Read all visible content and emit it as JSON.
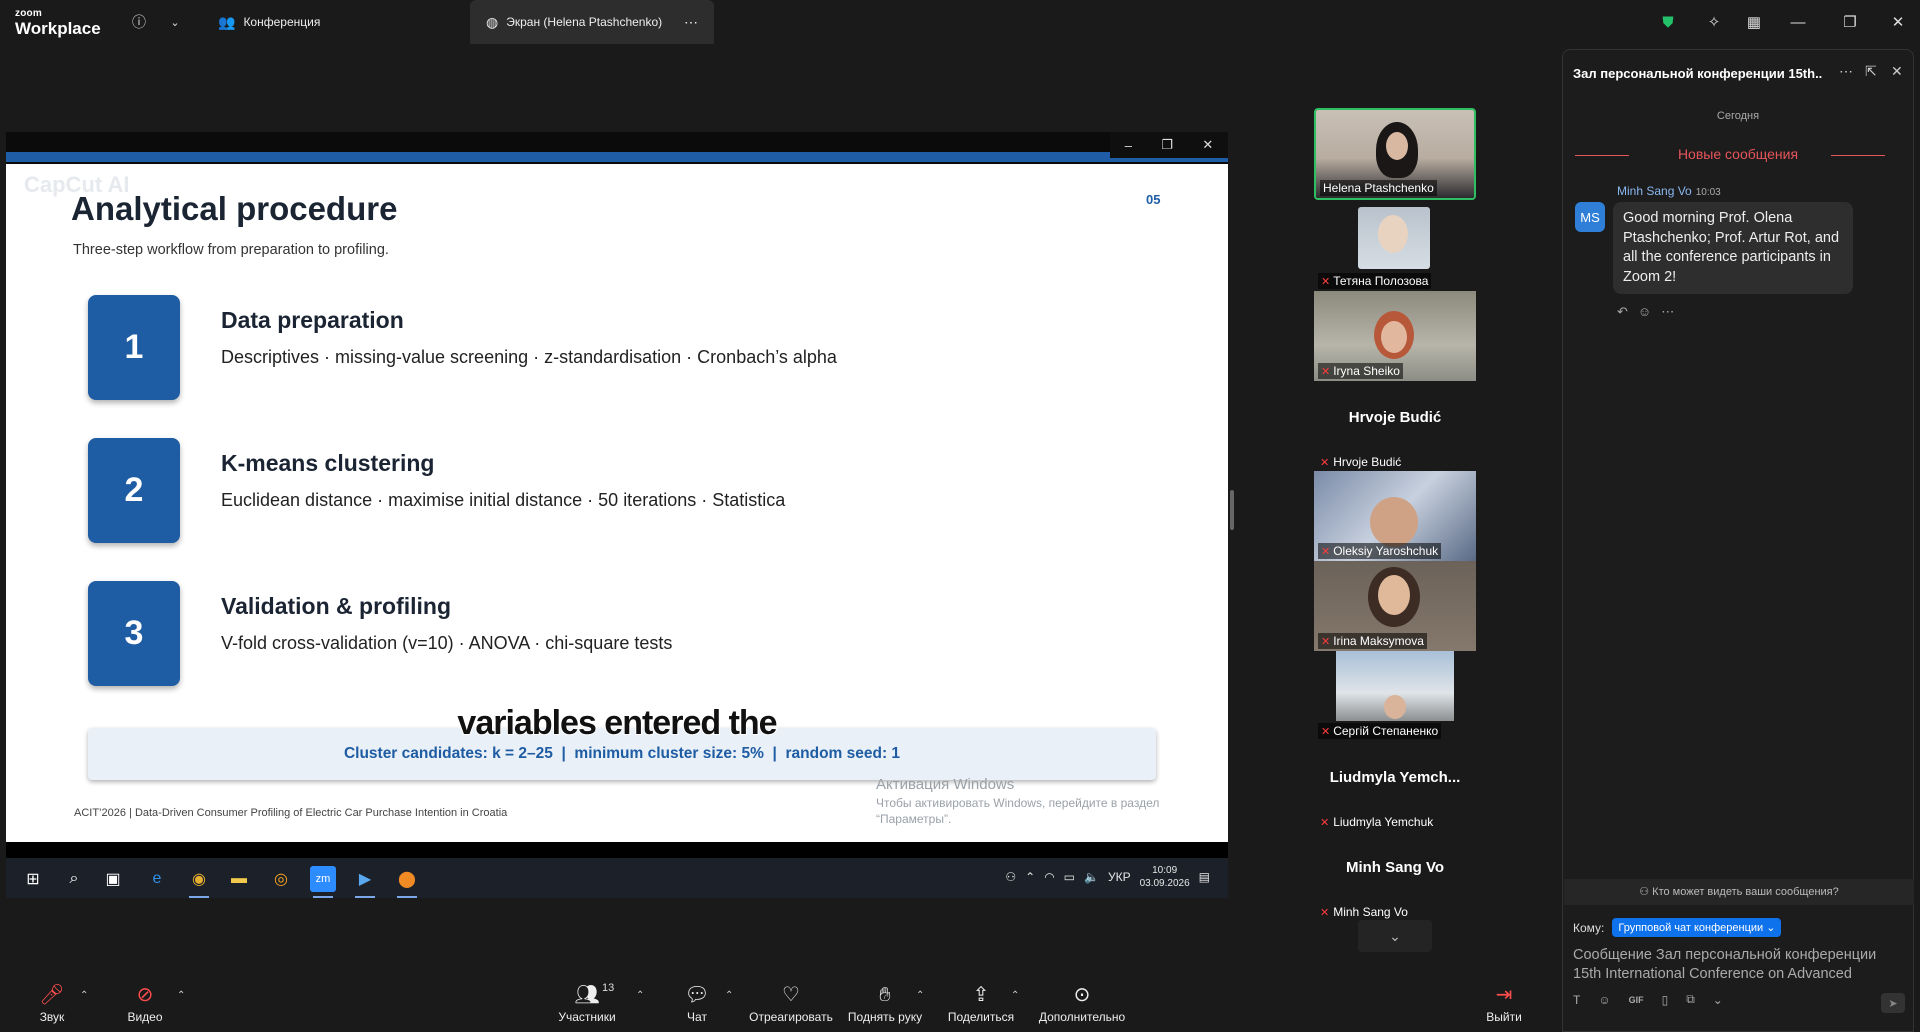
{
  "titlebar": {
    "logo_top": "zoom",
    "logo_bottom": "Workplace",
    "tab_conference": "Конференция",
    "tab_screen": "Экран (Helena Ptashchenko)"
  },
  "slide": {
    "watermark": "CapCut AI",
    "number": "05",
    "title": "Analytical procedure",
    "subtitle": "Three-step workflow from preparation to profiling.",
    "steps": [
      {
        "num": "1",
        "heading": "Data preparation",
        "desc": "Descriptives · missing-value screening · z-standardisation · Cronbach’s alpha"
      },
      {
        "num": "2",
        "heading": "K-means clustering",
        "desc": "Euclidean distance · maximise initial distance · 50 iterations · Statistica"
      },
      {
        "num": "3",
        "heading": "Validation & profiling",
        "desc": "V-fold cross-validation (v=10) · ANOVA · chi-square tests"
      }
    ],
    "candidates": "Cluster candidates: k = 2–25  |  minimum cluster size: 5%  |  random seed: 1",
    "caption": "variables entered the",
    "footer": "ACIT’2026  |  Data-Driven Consumer Profiling of Electric Car Purchase Intention in Croatia",
    "activation_title": "Активация Windows",
    "activation_text": "Чтобы активировать Windows, перейдите в раздел “Параметры”."
  },
  "taskbar": {
    "lang": "УКР",
    "time": "10:09",
    "date": "03.09.2026"
  },
  "gallery": {
    "tiles": [
      {
        "name": "Helena Ptashchenko"
      },
      {
        "name": "Тетяна Полозова"
      },
      {
        "name": "Iryna Sheiko"
      },
      {
        "name": "Hrvoje Budić",
        "big": "Hrvoje Budić"
      },
      {
        "name": "Oleksiy Yaroshchuk"
      },
      {
        "name": "Irina Maksymova"
      },
      {
        "name": "Сергій Степаненко"
      },
      {
        "name": "Liudmyla Yemchuk",
        "big": "Liudmyla  Yemch..."
      },
      {
        "name": "Minh Sang Vo",
        "big": "Minh Sang Vo"
      }
    ]
  },
  "chat": {
    "title": "Зал персональной конференции 15th...",
    "today": "Сегодня",
    "new_messages": "Новые сообщения",
    "message": {
      "avatar": "MS",
      "sender": "Minh Sang Vo",
      "time": "10:03",
      "text": "Good morning Prof. Olena Ptashchenko; Prof. Artur Rot, and all the conference participants in Zoom 2!"
    },
    "who_sees": "Кто может видеть ваши сообщения?",
    "to_label": "Кому:",
    "to_value": "Групповой чат конференции",
    "compose_placeholder": "Сообщение Зал персональной конференции 15th International Conference on Advanced"
  },
  "toolbar": {
    "audio": "Звук",
    "video": "Видео",
    "participants": "Участники",
    "participants_count": "13",
    "chat": "Чат",
    "react": "Отреагировать",
    "raise_hand": "Поднять руку",
    "share": "Поделиться",
    "more": "Дополнительно",
    "leave": "Выйти"
  }
}
